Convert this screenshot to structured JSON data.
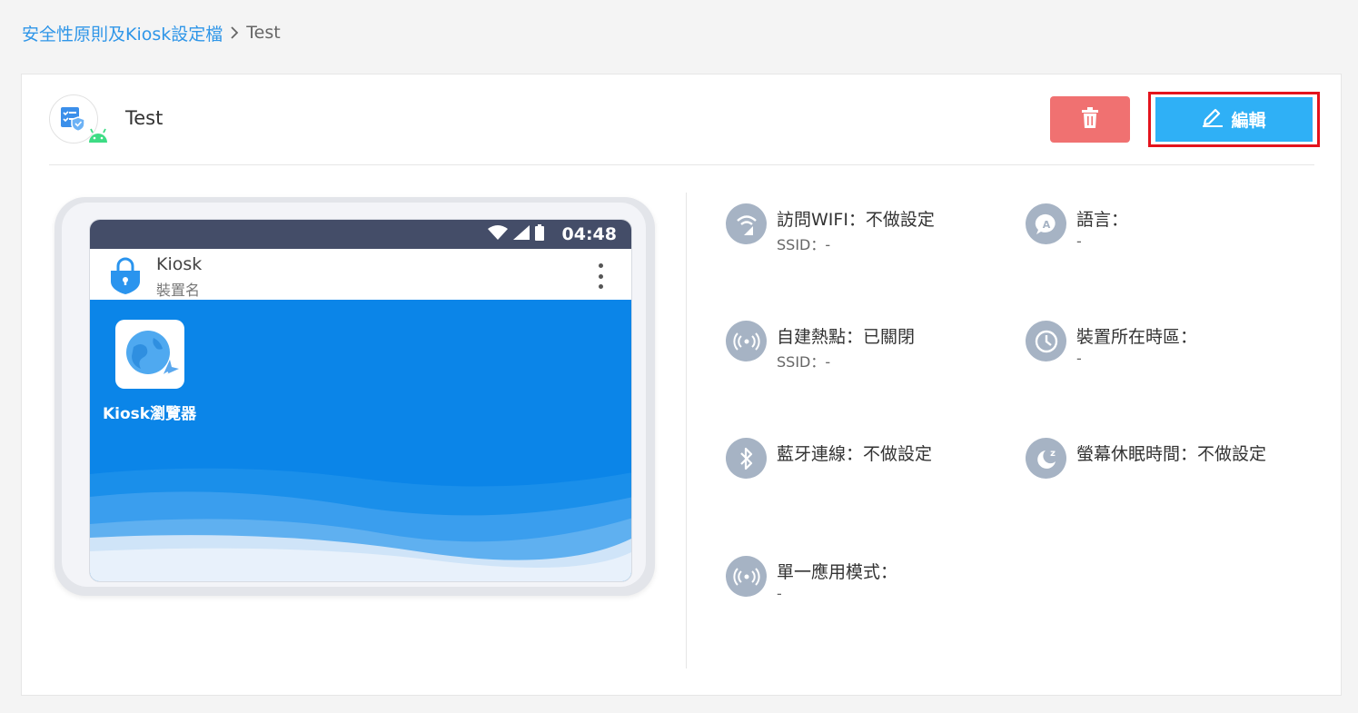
{
  "breadcrumb": {
    "parent": "安全性原則及Kiosk設定檔",
    "separator_icon": "chevron-right-icon",
    "current": "Test"
  },
  "profile": {
    "name": "Test",
    "icon": "policy-checklist-icon",
    "platform_icon": "android-icon"
  },
  "actions": {
    "delete_icon": "trash-icon",
    "edit_label": "編輯",
    "edit_icon": "pencil-icon"
  },
  "colors": {
    "link": "#2f96e8",
    "delete": "#f07171",
    "edit": "#2fb0f6",
    "highlight": "#e4131d",
    "setting_icon_bg": "#a6b3c4",
    "status_bar": "#444d68",
    "home_bg": "#0b85e8"
  },
  "device": {
    "time": "04:48",
    "app_title": "Kiosk",
    "app_subtitle": "裝置名",
    "app_label": "Kiosk瀏覽器"
  },
  "settings": [
    {
      "title": "訪問WIFI：不做設定",
      "sub": "SSID：-",
      "icon": "wifi-icon"
    },
    {
      "title": "語言：",
      "sub": "-",
      "icon": "language-icon"
    },
    {
      "title": "自建熱點：已關閉",
      "sub": "SSID：-",
      "icon": "hotspot-icon"
    },
    {
      "title": "裝置所在時區：",
      "sub": "-",
      "icon": "clock-icon"
    },
    {
      "title": "藍牙連線：不做設定",
      "sub": "",
      "icon": "bluetooth-icon"
    },
    {
      "title": "螢幕休眠時間：不做設定",
      "sub": "",
      "icon": "sleep-moon-icon"
    },
    {
      "title": "單一應用模式：",
      "sub": "-",
      "icon": "single-app-icon"
    }
  ]
}
